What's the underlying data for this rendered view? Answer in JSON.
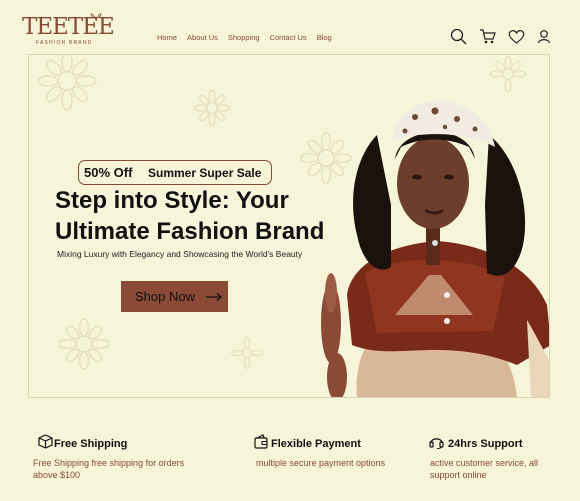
{
  "logo": {
    "wordmark": "TEETEE",
    "tagline": "FASHION BRAND"
  },
  "nav": [
    {
      "label": "Home"
    },
    {
      "label": "About Us"
    },
    {
      "label": "Shopping"
    },
    {
      "label": "Contact Us"
    },
    {
      "label": "Blog"
    }
  ],
  "header_icons": [
    "search-icon",
    "cart-icon",
    "heart-icon",
    "user-icon"
  ],
  "hero": {
    "badge_discount": "50% Off",
    "badge_text": "Summer Super Sale",
    "headline": "Step into Style: Your Ultimate Fashion Brand",
    "subline": "Mixing Luxury with Elegancy and Showcasing the World's Beauty",
    "cta_label": "Shop Now"
  },
  "features": [
    {
      "icon": "box-icon",
      "title": "Free Shipping",
      "description": "Free Shipping free shipping for orders above $100"
    },
    {
      "icon": "wallet-icon",
      "title": "Flexible Payment",
      "description": "multiple secure payment options"
    },
    {
      "icon": "headset-icon",
      "title": "24hrs Support",
      "description": "active customer service, all support online"
    }
  ],
  "colors": {
    "background": "#f6f4d9",
    "accent": "#8a4a35",
    "text": "#111111"
  }
}
